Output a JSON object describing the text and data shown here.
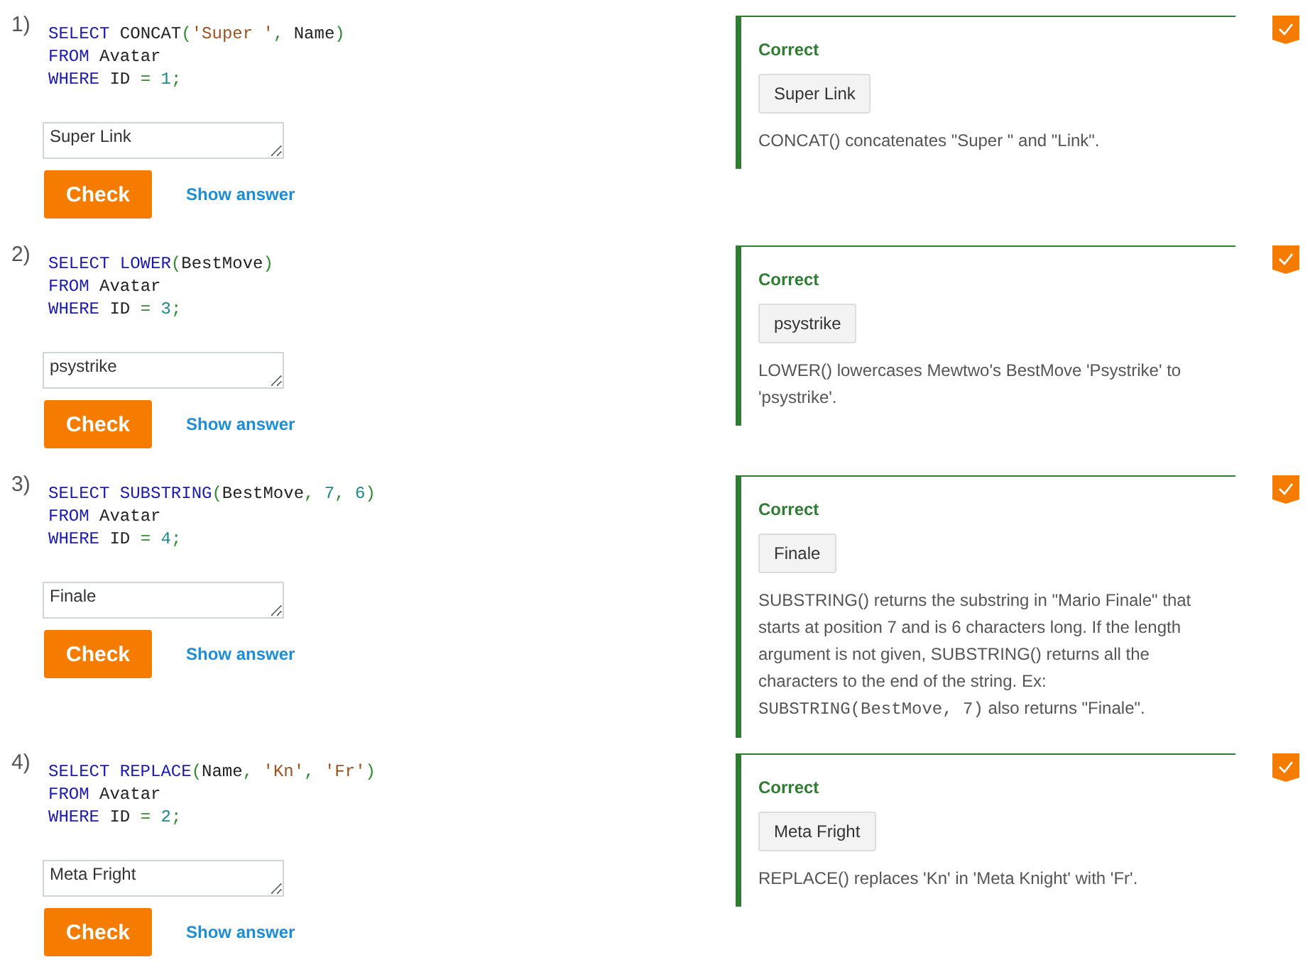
{
  "questions": [
    {
      "number": "1)",
      "code": [
        [
          {
            "kind": "keyword",
            "text": "SELECT"
          },
          {
            "kind": "plain",
            "text": " CONCAT"
          },
          {
            "kind": "punct",
            "text": "("
          },
          {
            "kind": "string",
            "text": "'Super '"
          },
          {
            "kind": "punct",
            "text": ","
          },
          {
            "kind": "plain",
            "text": " Name"
          },
          {
            "kind": "punct",
            "text": ")"
          }
        ],
        [
          {
            "kind": "keyword",
            "text": "FROM"
          },
          {
            "kind": "plain",
            "text": " Avatar"
          }
        ],
        [
          {
            "kind": "keyword",
            "text": "WHERE"
          },
          {
            "kind": "plain",
            "text": " ID "
          },
          {
            "kind": "punct",
            "text": "="
          },
          {
            "kind": "number",
            "text": " 1"
          },
          {
            "kind": "punct",
            "text": ";"
          }
        ]
      ],
      "answer": "Super Link",
      "check_label": "Check",
      "show_answer_label": "Show answer",
      "done": true,
      "feedback": {
        "status": "Correct",
        "correct": true,
        "answer": "Super Link",
        "explanation": [
          {
            "kind": "text",
            "text": "CONCAT() concatenates \"Super \" and \"Link\"."
          }
        ]
      }
    },
    {
      "number": "2)",
      "code": [
        [
          {
            "kind": "keyword",
            "text": "SELECT LOWER"
          },
          {
            "kind": "punct",
            "text": "("
          },
          {
            "kind": "plain",
            "text": "BestMove"
          },
          {
            "kind": "punct",
            "text": ")"
          }
        ],
        [
          {
            "kind": "keyword",
            "text": "FROM"
          },
          {
            "kind": "plain",
            "text": " Avatar"
          }
        ],
        [
          {
            "kind": "keyword",
            "text": "WHERE"
          },
          {
            "kind": "plain",
            "text": " ID "
          },
          {
            "kind": "punct",
            "text": "="
          },
          {
            "kind": "number",
            "text": " 3"
          },
          {
            "kind": "punct",
            "text": ";"
          }
        ]
      ],
      "answer": "psystrike",
      "check_label": "Check",
      "show_answer_label": "Show answer",
      "done": true,
      "feedback": {
        "status": "Correct",
        "correct": true,
        "answer": "psystrike",
        "explanation": [
          {
            "kind": "text",
            "text": "LOWER() lowercases Mewtwo's BestMove 'Psystrike' to 'psystrike'."
          }
        ]
      }
    },
    {
      "number": "3)",
      "code": [
        [
          {
            "kind": "keyword",
            "text": "SELECT SUBSTRING"
          },
          {
            "kind": "punct",
            "text": "("
          },
          {
            "kind": "plain",
            "text": "BestMove"
          },
          {
            "kind": "punct",
            "text": ","
          },
          {
            "kind": "number",
            "text": " 7"
          },
          {
            "kind": "punct",
            "text": ","
          },
          {
            "kind": "number",
            "text": " 6"
          },
          {
            "kind": "punct",
            "text": ")"
          }
        ],
        [
          {
            "kind": "keyword",
            "text": "FROM"
          },
          {
            "kind": "plain",
            "text": " Avatar"
          }
        ],
        [
          {
            "kind": "keyword",
            "text": "WHERE"
          },
          {
            "kind": "plain",
            "text": " ID "
          },
          {
            "kind": "punct",
            "text": "="
          },
          {
            "kind": "number",
            "text": " 4"
          },
          {
            "kind": "punct",
            "text": ";"
          }
        ]
      ],
      "answer": "Finale",
      "check_label": "Check",
      "show_answer_label": "Show answer",
      "done": true,
      "feedback": {
        "status": "Correct",
        "correct": true,
        "answer": "Finale",
        "explanation": [
          {
            "kind": "text",
            "text": "SUBSTRING() returns the substring in \"Mario Finale\" that starts at position 7 and is 6 characters long. If the length argument is not given, SUBSTRING() returns all the characters to the end of the string. Ex: "
          },
          {
            "kind": "code",
            "text": "SUBSTRING(BestMove, 7)"
          },
          {
            "kind": "text",
            "text": " also returns \"Finale\"."
          }
        ]
      }
    },
    {
      "number": "4)",
      "code": [
        [
          {
            "kind": "keyword",
            "text": "SELECT REPLACE"
          },
          {
            "kind": "punct",
            "text": "("
          },
          {
            "kind": "plain",
            "text": "Name"
          },
          {
            "kind": "punct",
            "text": ","
          },
          {
            "kind": "string",
            "text": " 'Kn'"
          },
          {
            "kind": "punct",
            "text": ","
          },
          {
            "kind": "string",
            "text": " 'Fr'"
          },
          {
            "kind": "punct",
            "text": ")"
          }
        ],
        [
          {
            "kind": "keyword",
            "text": "FROM"
          },
          {
            "kind": "plain",
            "text": " Avatar"
          }
        ],
        [
          {
            "kind": "keyword",
            "text": "WHERE"
          },
          {
            "kind": "plain",
            "text": " ID "
          },
          {
            "kind": "punct",
            "text": "="
          },
          {
            "kind": "number",
            "text": " 2"
          },
          {
            "kind": "punct",
            "text": ";"
          }
        ]
      ],
      "answer": "Meta Fright",
      "check_label": "Check",
      "show_answer_label": "Show answer",
      "done": true,
      "feedback": {
        "status": "Correct",
        "correct": true,
        "answer": "Meta Fright",
        "explanation": [
          {
            "kind": "text",
            "text": "REPLACE() replaces 'Kn' in 'Meta Knight' with 'Fr'."
          }
        ]
      }
    }
  ]
}
